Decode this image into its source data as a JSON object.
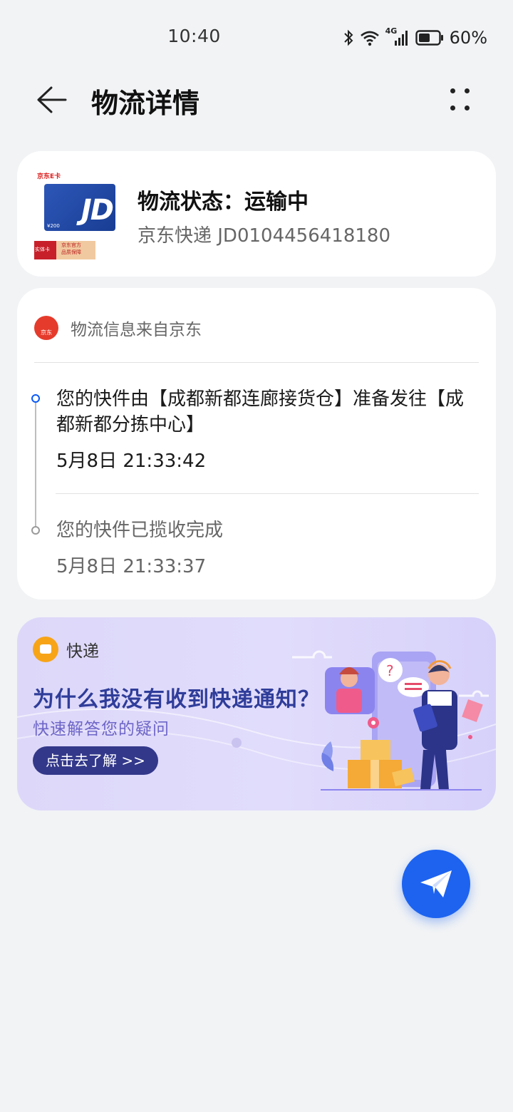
{
  "status_bar": {
    "time": "10:40",
    "network": "4G",
    "battery": "60%"
  },
  "header": {
    "title": "物流详情",
    "back_icon": "arrow-left-icon",
    "more_icon": "more-dots-icon"
  },
  "shipment": {
    "status": "物流状态：运输中",
    "carrier_and_number": "京东快递 JD0104456418180",
    "product_image": {
      "top_label": "京东E卡",
      "logo_text": "JD",
      "price_text": "¥200",
      "ribbon_left": "实体卡",
      "ribbon_right_1": "京东官方",
      "ribbon_right_2": "品质保障"
    }
  },
  "tracking": {
    "source": "物流信息来自京东",
    "source_logo_text": "京东",
    "events": [
      {
        "text": "您的快件由【成都新都连廊接货仓】准备发往【成都新都分拣中心】",
        "time": "5月8日 21:33:42",
        "active": true
      },
      {
        "text": "您的快件已揽收完成",
        "time": "5月8日 21:33:37",
        "active": false
      }
    ]
  },
  "promo": {
    "label": "快递",
    "title": "为什么我没有收到快递通知？",
    "subtitle": "快速解答您的疑问",
    "button": "点击去了解 >>"
  },
  "fab": {
    "icon": "send-icon"
  },
  "colors": {
    "accent": "#0a59f7",
    "fab": "#1d63f0",
    "promo_title": "#2f3d9a",
    "promo_button": "#33388a"
  }
}
